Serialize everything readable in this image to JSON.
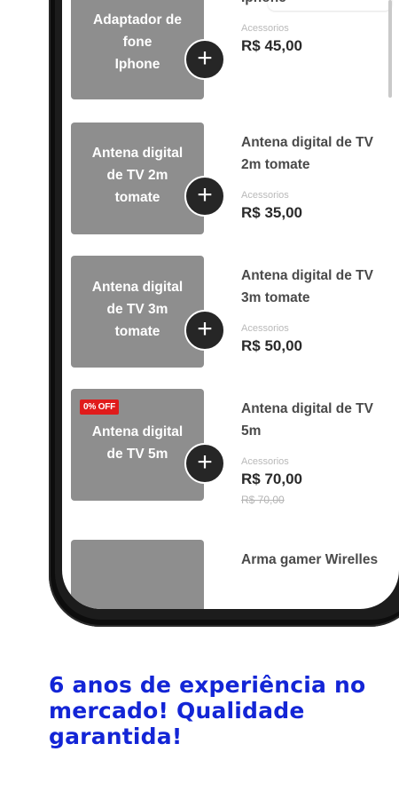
{
  "products": [
    {
      "thumb_title": "Adaptador de fone Iphone",
      "name": "Adaptador de fone Iphone",
      "name_line1": "Adaptador de fone",
      "name_line2": "Iphone",
      "category": "Acessorios",
      "price": "R$ 45,00"
    },
    {
      "thumb_title_l1": "Antena digital",
      "thumb_title_l2": "de TV 2m",
      "thumb_title_l3": "tomate",
      "name_line1": "Antena digital de TV",
      "name_line2": "2m tomate",
      "category": "Acessorios",
      "price": "R$ 35,00"
    },
    {
      "thumb_title_l1": "Antena digital",
      "thumb_title_l2": "de TV 3m",
      "thumb_title_l3": "tomate",
      "name_line1": "Antena digital de TV",
      "name_line2": "3m tomate",
      "category": "Acessorios",
      "price": "R$ 50,00"
    },
    {
      "badge": "0% OFF",
      "thumb_title_l1": "Antena digital",
      "thumb_title_l2": "de TV 5m",
      "name_line1": "Antena digital de TV",
      "name_line2": "5m",
      "category": "Acessorios",
      "price": "R$ 70,00",
      "old_price": "R$ 70,00"
    },
    {
      "name_line1": "Arma gamer Wirelles"
    }
  ],
  "add_symbol": "+",
  "headline": "6 anos de experiência no mercado! Qualidade garantida!",
  "colors": {
    "headline": "#1325d6",
    "badge": "#e01b1b",
    "thumb": "#8e8e8e",
    "add_button": "#262626"
  }
}
